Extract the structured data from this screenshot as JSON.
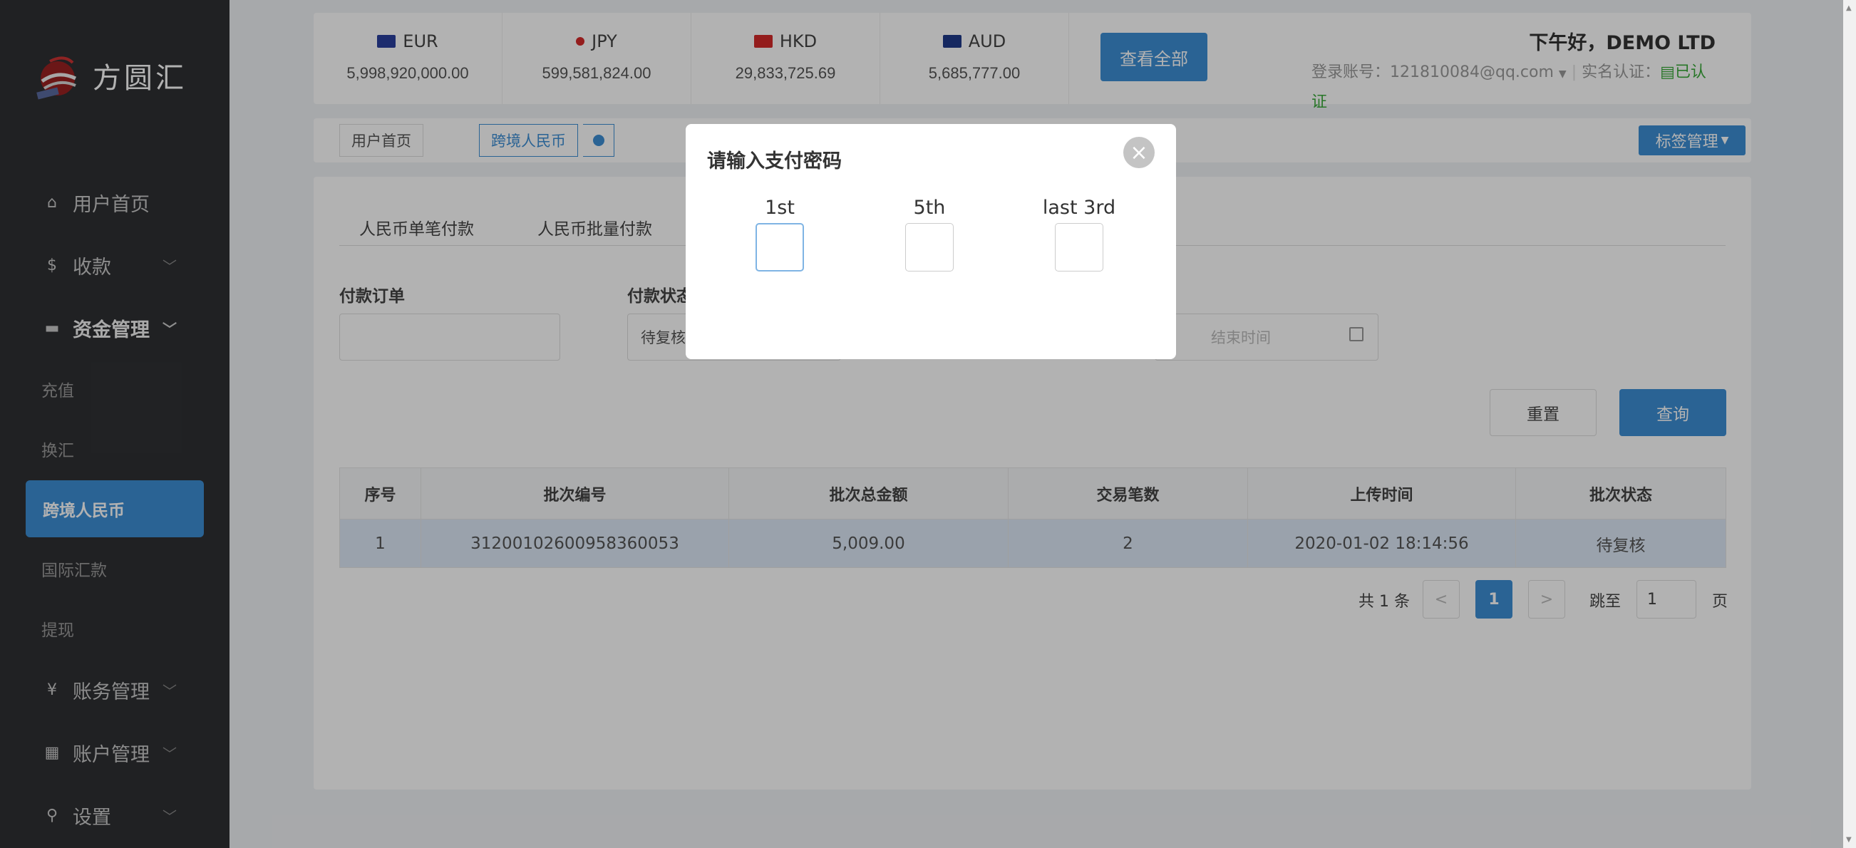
{
  "sidebar": {
    "brand": "方圆汇",
    "items": [
      {
        "label": "用户首页",
        "icon": "home-icon",
        "glyph": "⌂"
      },
      {
        "label": "收款",
        "icon": "dollar-icon",
        "glyph": "$"
      },
      {
        "label": "资金管理",
        "icon": "card-icon",
        "glyph": "▬"
      },
      {
        "label": "充值"
      },
      {
        "label": "换汇"
      },
      {
        "label": "跨境人民币"
      },
      {
        "label": "国际汇款"
      },
      {
        "label": "提现"
      },
      {
        "label": "账务管理",
        "icon": "yen-icon",
        "glyph": "¥"
      },
      {
        "label": "账户管理",
        "icon": "account-icon",
        "glyph": "▦"
      },
      {
        "label": "设置",
        "icon": "search-icon",
        "glyph": "⚲"
      }
    ]
  },
  "currencies": [
    {
      "code": "EUR",
      "amount": "5,998,920,000.00"
    },
    {
      "code": "JPY",
      "amount": "599,581,824.00"
    },
    {
      "code": "HKD",
      "amount": "29,833,725.69"
    },
    {
      "code": "AUD",
      "amount": "5,685,777.00"
    }
  ],
  "header": {
    "view_all": "查看全部",
    "greeting": "下午好，DEMO LTD",
    "login_label": "登录账号：",
    "login_account": "121810084@qq.com",
    "verify_label": "实名认证：",
    "verify_status": "已认证"
  },
  "tabs": {
    "home": "用户首页",
    "active": "跨境人民币",
    "tag_manage": "标签管理"
  },
  "panel": {
    "subtabs": [
      "人民币单笔付款",
      "人民币批量付款"
    ],
    "order_label": "付款订单",
    "status_label": "付款状态",
    "status_value": "待复核",
    "end_time_placeholder": "结束时间",
    "reset": "重置",
    "query": "查询"
  },
  "table": {
    "headers": [
      "序号",
      "批次编号",
      "批次总金额",
      "交易笔数",
      "上传时间",
      "批次状态"
    ],
    "rows": [
      [
        "1",
        "31200102600958360053",
        "5,009.00",
        "2",
        "2020-01-02 18:14:56",
        "待复核"
      ]
    ]
  },
  "pagination": {
    "total": "共 1 条",
    "prev": "<",
    "current": "1",
    "next": ">",
    "jump_label": "跳至",
    "jump_value": "1",
    "page_suffix": "页"
  },
  "modal": {
    "title": "请输入支付密码",
    "close": "×",
    "fields": [
      {
        "label": "1st"
      },
      {
        "label": "5th"
      },
      {
        "label": "last 3rd"
      }
    ]
  },
  "colors": {
    "accent": "#3d8ed4",
    "sidebar": "#2f3033",
    "verified": "#3aaa3a"
  }
}
